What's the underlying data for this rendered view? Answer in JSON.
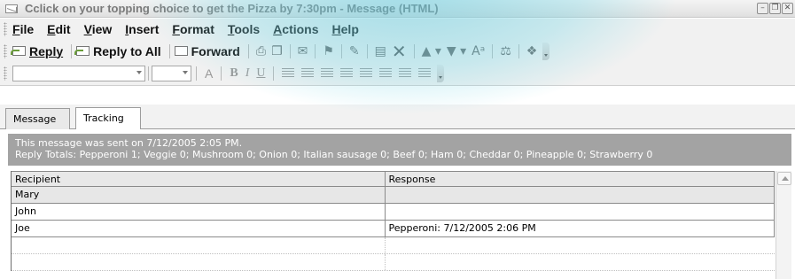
{
  "window": {
    "title": "Cclick on your topping choice to get the Pizza by 7:30pm  - Message (HTML)",
    "controls": [
      "minimize",
      "restore",
      "close"
    ]
  },
  "menu": {
    "items": [
      "File",
      "Edit",
      "View",
      "Insert",
      "Format",
      "Tools",
      "Actions",
      "Help"
    ]
  },
  "toolbar": {
    "reply_label": "Reply",
    "reply_all_label": "Reply to All",
    "forward_label": "Forward",
    "icons": [
      "print-icon",
      "copy-icon",
      "move-icon",
      "flag-icon",
      "categorize-icon",
      "address-book-icon",
      "delete-icon",
      "previous-item-icon",
      "next-item-icon",
      "font-size-icon",
      "junk-icon",
      "help-icon"
    ]
  },
  "format_toolbar": {
    "font_value": "",
    "size_value": "",
    "buttons": [
      "A",
      "B",
      "I",
      "U"
    ]
  },
  "tabs": [
    "Message",
    "Tracking"
  ],
  "active_tab": "Tracking",
  "tracking": {
    "sent_line": "This message was sent on 7/12/2005 2:05 PM.",
    "totals_line": "Reply Totals: Pepperoni 1; Veggie 0; Mushroom 0; Onion 0; Italian sausage 0; Beef 0; Ham 0; Cheddar 0; Pineapple 0; Strawberry 0",
    "columns": [
      "Recipient",
      "Response"
    ],
    "rows": [
      {
        "recipient": "Mary",
        "response": ""
      },
      {
        "recipient": "John",
        "response": ""
      },
      {
        "recipient": "Joe",
        "response": "Pepperoni: 7/12/2005 2:06 PM"
      }
    ]
  },
  "colors": {
    "info_bar": "#a3a3a3",
    "watermark": "#5ac8dc"
  }
}
